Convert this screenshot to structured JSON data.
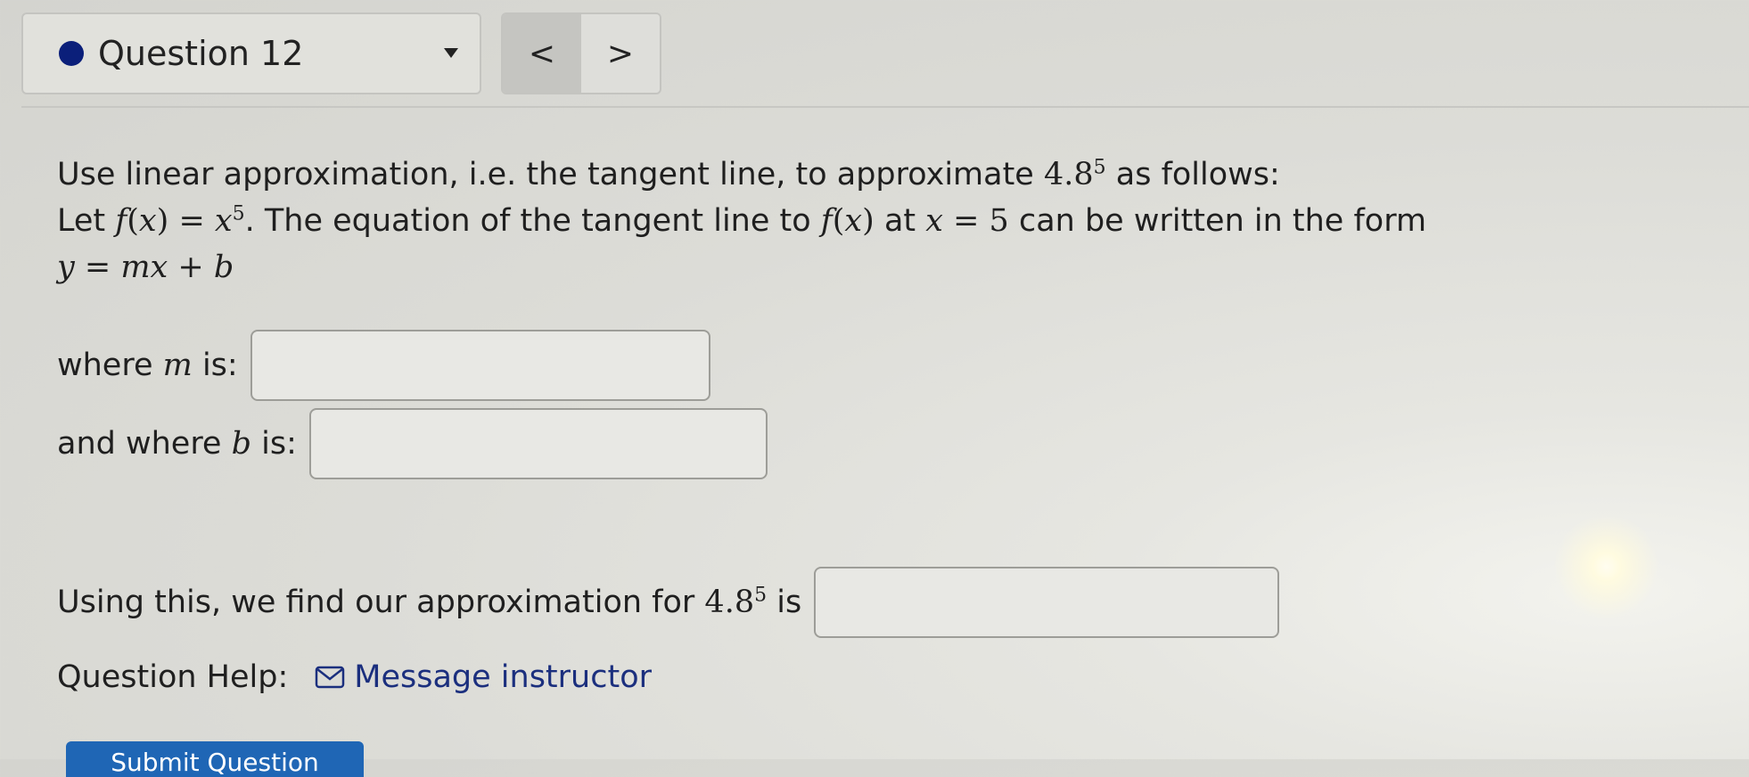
{
  "question_nav": {
    "label": "Question 12",
    "prev_symbol": "<",
    "next_symbol": ">"
  },
  "problem": {
    "line1_text_a": "Use linear approximation, i.e. the tangent line, to approximate ",
    "line1_math_base": "4.8",
    "line1_math_exp": "5",
    "line1_text_b": " as follows:",
    "line2_let": "Let ",
    "line2_fx": "f",
    "line2_fx_paren_open": "(",
    "line2_fx_var": "x",
    "line2_fx_paren_close": ")",
    "line2_eq": " = ",
    "line2_xbase": "x",
    "line2_xexp": "5",
    "line2_text_a": ". The equation of the tangent line to ",
    "line2_fx2": "f",
    "line2_fx2_open": "(",
    "line2_fx2_var": "x",
    "line2_fx2_close": ")",
    "line2_text_b": " at ",
    "line2_x": "x",
    "line2_eq2": " = 5",
    "line2_text_c": " can be written in the form",
    "line3_y": "y",
    "line3_eq": " = ",
    "line3_mx": "mx",
    "line3_plus": " + ",
    "line3_b": "b"
  },
  "field_m": {
    "label_prefix": "where ",
    "label_var": "m",
    "label_suffix": " is:",
    "value": ""
  },
  "field_b": {
    "label_prefix": "and where ",
    "label_var": "b",
    "label_suffix": " is:",
    "value": ""
  },
  "field_approx": {
    "label_text": "Using this, we find our approximation for ",
    "label_math_base": "4.8",
    "label_math_exp": "5",
    "label_suffix": " is",
    "value": ""
  },
  "help": {
    "label": "Question Help:",
    "icon": "envelope-icon",
    "link_text": "Message instructor"
  },
  "submit": {
    "label": "Submit Question"
  },
  "colors": {
    "question_dot": "#0b1f7a",
    "link": "#1b2f7e",
    "submit_bg": "#1f66b5"
  }
}
